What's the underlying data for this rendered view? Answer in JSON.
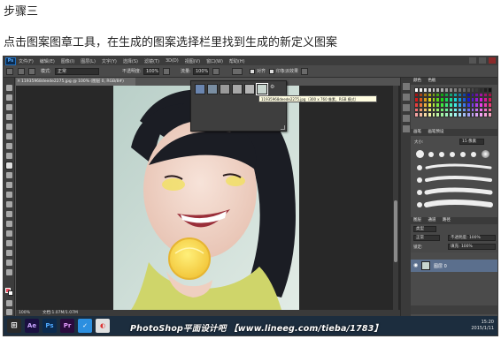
{
  "caption": {
    "title": "步骤三",
    "text": "点击图案图章工具，在生成的图案选择栏里找到生成的新定义图案"
  },
  "app": {
    "logo": "Ps",
    "menu": [
      "文件(F)",
      "编辑(E)",
      "图像(I)",
      "图层(L)",
      "文字(Y)",
      "选择(S)",
      "滤镜(T)",
      "3D(D)",
      "视图(V)",
      "窗口(W)",
      "帮助(H)"
    ]
  },
  "options_bar": {
    "mode_label": "模式:",
    "mode_value": "正常",
    "opacity_label": "不透明度:",
    "opacity_value": "100%",
    "flow_label": "流量:",
    "flow_value": "100%",
    "aligned_label": "对齐",
    "impressionist_label": "印象派效果"
  },
  "document": {
    "tab_title": "11935968deede2275.jpg @ 100% (图层 0, RGB/8#)",
    "status_zoom": "100%",
    "status_doc": "文档:1.07M/1.07M"
  },
  "pattern_picker": {
    "tooltip": "11935968deede2275.jpg（300 x 760 像素，RGB 模式）"
  },
  "panels": {
    "swatch_tabs": [
      "颜色",
      "色板"
    ],
    "brush_tabs": [
      "画笔",
      "画笔预设"
    ],
    "brush_size_label": "大小:",
    "brush_size_value": "15 像素",
    "layers_tabs": [
      "图层",
      "通道",
      "路径"
    ],
    "layers_filter": "类型",
    "blend_mode": "正常",
    "layers_opacity": "不透明度: 100%",
    "lock_label": "锁定:",
    "fill": "填充: 100%",
    "layer_name": "图层 0"
  },
  "colors": {
    "foreground": "#e94a5b",
    "background": "#ffffff"
  },
  "taskbar": {
    "apps": [
      "Ae",
      "Ps",
      "Pr"
    ],
    "watermark": "PhotoShop平面设计吧 【www.lineeg.com/tieba/1783】",
    "time": "15:20",
    "date": "2015/1/11"
  }
}
